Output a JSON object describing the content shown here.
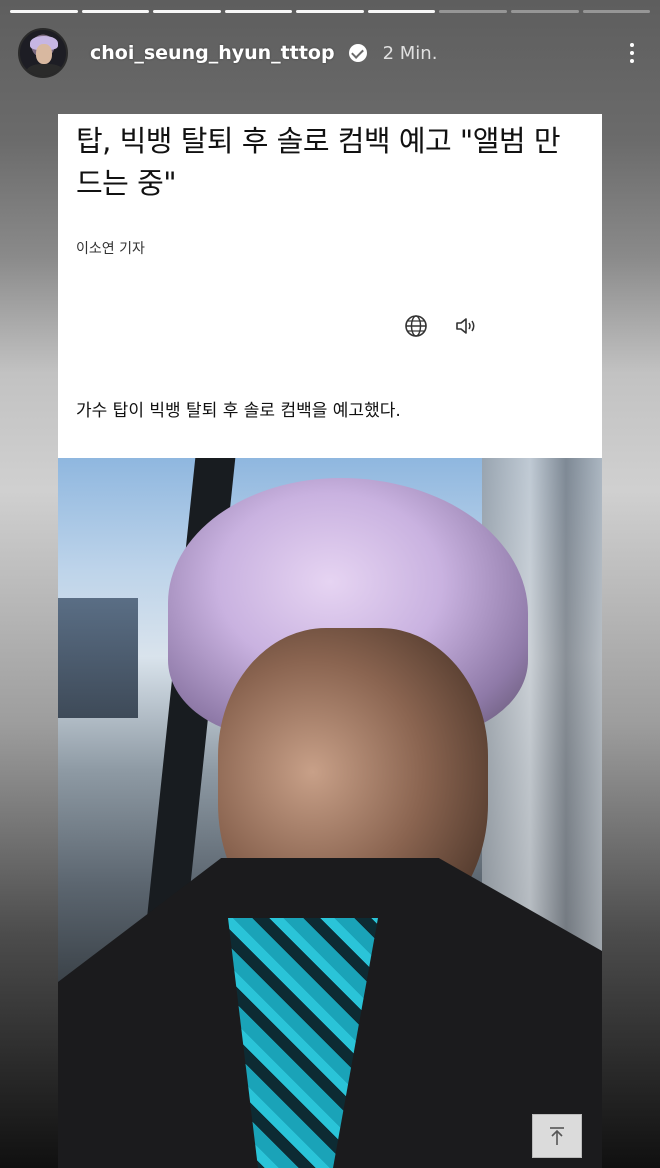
{
  "story": {
    "progress_segments": 9,
    "progress_done": 6,
    "username": "choi_seung_hyun_tttop",
    "time": "2 Min.",
    "verified": true
  },
  "article": {
    "headline": "탑, 빅뱅 탈퇴 후 솔로 컴백 예고 \"앨범 만드는 중\"",
    "reporter": "이소연 기자",
    "lead": "가수 탑이 빅뱅 탈퇴 후 솔로 컴백을 예고했다.",
    "icons": [
      "globe-icon",
      "speaker-icon"
    ]
  },
  "colors": {
    "card_bg": "#ffffff",
    "text": "#111111",
    "shirt_accent": "#1aa3b8"
  }
}
